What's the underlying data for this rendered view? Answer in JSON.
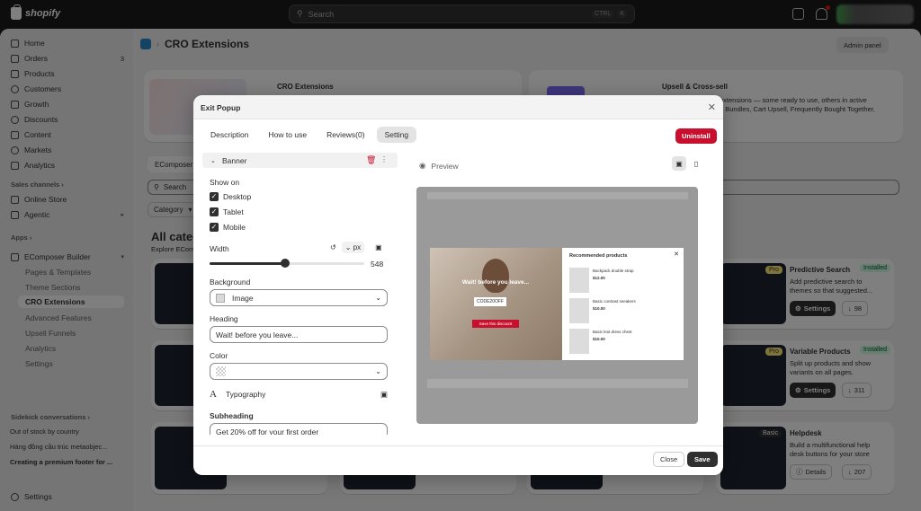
{
  "topbar": {
    "brand": "shopify",
    "search_placeholder": "Search",
    "shortcut_1": "CTRL",
    "shortcut_2": "K"
  },
  "sidebar": {
    "nav": [
      {
        "label": "Home"
      },
      {
        "label": "Orders",
        "count": "3"
      },
      {
        "label": "Products"
      },
      {
        "label": "Customers"
      },
      {
        "label": "Growth"
      },
      {
        "label": "Discounts"
      },
      {
        "label": "Content"
      },
      {
        "label": "Markets"
      },
      {
        "label": "Analytics"
      }
    ],
    "sales_channels_heading": "Sales channels",
    "channels": [
      {
        "label": "Online Store"
      },
      {
        "label": "Agentic"
      }
    ],
    "apps_heading": "Apps",
    "app_name": "EComposer Builder",
    "app_sub": [
      {
        "label": "Pages & Templates"
      },
      {
        "label": "Theme Sections"
      },
      {
        "label": "CRO Extensions"
      },
      {
        "label": "Advanced Features"
      },
      {
        "label": "Upsell Funnels"
      },
      {
        "label": "Analytics"
      },
      {
        "label": "Settings"
      }
    ],
    "sidekick_heading": "Sidekick conversations",
    "conversations": [
      {
        "label": "Out of stock by country"
      },
      {
        "label": "Hàng đồng cầu trúc metaobjec..."
      },
      {
        "label": "Creating a premium footer for ..."
      }
    ],
    "settings": "Settings"
  },
  "page": {
    "title": "CRO Extensions",
    "admin_panel": "Admin panel",
    "banner_left_title": "CRO Extensions",
    "banner_right_title": "Upsell & Cross-sell",
    "banner_right_desc_1": "extensions — some ready to use, others in active",
    "banner_right_desc_2": "e Bundles, Cart Upsell, Frequently Bought Together,",
    "tab_partial": "EComposer",
    "search_partial": "Search",
    "category_filter": "Category",
    "section_title_partial": "All categ",
    "section_sub_partial": "Explore EComp",
    "apps": [
      {
        "name": "Predictive Search",
        "tier": "Pro",
        "status": "Installed",
        "desc_1": "Add predictive search to",
        "desc_2": "themes so that suggested...",
        "button": "Settings",
        "downloads": "98"
      },
      {
        "name": "Variable Products",
        "tier": "Pro",
        "status": "Installed",
        "desc_1": "Split up products and show",
        "desc_2": "variants on all pages.",
        "button": "Settings",
        "downloads": "311"
      },
      {
        "name": "Helpdesk",
        "tier": "Basic",
        "status": "",
        "desc_1": "Build a multifunctional help",
        "desc_2": "desk buttons for your store",
        "button": "Details",
        "downloads": "207"
      }
    ]
  },
  "modal": {
    "title": "Exit Popup",
    "tabs": [
      {
        "label": "Description"
      },
      {
        "label": "How to use"
      },
      {
        "label": "Reviews(0)"
      },
      {
        "label": "Setting"
      }
    ],
    "uninstall": "Uninstall",
    "banner_row": "Banner",
    "show_on": "Show on",
    "devices": [
      {
        "label": "Desktop",
        "checked": true
      },
      {
        "label": "Tablet",
        "checked": true
      },
      {
        "label": "Mobile",
        "checked": true
      }
    ],
    "width_label": "Width",
    "width_unit": "px",
    "width_value": "548",
    "width_fraction": 0.49,
    "background_label": "Background",
    "background_value": "Image",
    "heading_label": "Heading",
    "heading_value": "Wait! before you leave...",
    "color_label": "Color",
    "typography_label": "Typography",
    "subheading_label": "Subheading",
    "subheading_value": "Get 20% off for your first order",
    "preview_label": "Preview",
    "popup": {
      "headline": "Wait! before you leave...",
      "code": "CODE20OFF",
      "cta": "Save this discount",
      "rec_title": "Recommended products",
      "products": [
        {
          "name": "Backpack double strap",
          "price": "$12.00"
        },
        {
          "name": "Basic contrast sneakers",
          "price": "$10.00"
        },
        {
          "name": "Basic knit dress chest",
          "price": "$10.00"
        }
      ]
    },
    "close": "Close",
    "save": "Save"
  },
  "colors": {
    "accent_red": "#c8102e",
    "installed_green": "#cdfee1",
    "pro_yellow": "#ffeb78"
  }
}
